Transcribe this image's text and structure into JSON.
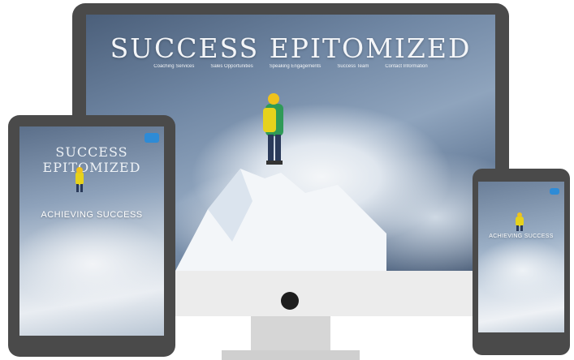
{
  "desktop": {
    "hero_title": "SUCCESS EPITOMIZED",
    "nav": [
      "Coaching Services",
      "Sales Opportunities",
      "Speaking Engagements",
      "Success Team",
      "Contact Information"
    ]
  },
  "tablet": {
    "hero_title": "SUCCESS EPITOMIZED",
    "tagline": "ACHIEVING SUCCESS"
  },
  "phone": {
    "tagline": "ACHIEVING SUCCESS"
  },
  "colors": {
    "bezel": "#4a4a4a",
    "menu_button": "#2e8bd6",
    "jacket_yellow": "#e6d21c",
    "jacket_green": "#2f9a57"
  }
}
